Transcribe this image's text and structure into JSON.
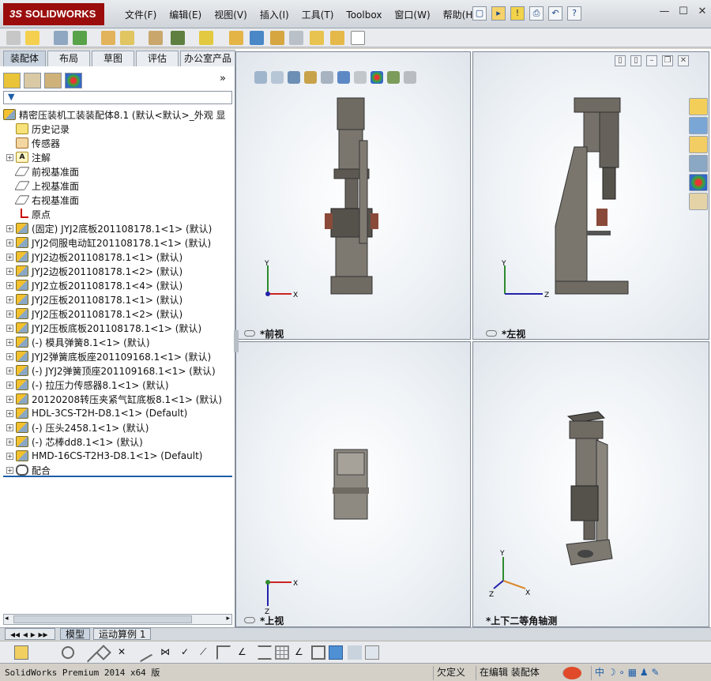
{
  "app": {
    "logo_ds": "3S",
    "logo_text": "SOLIDWORKS"
  },
  "menu": [
    "文件(F)",
    "编辑(E)",
    "视图(V)",
    "插入(I)",
    "工具(T)",
    "Toolbox",
    "窗口(W)",
    "帮助(H)"
  ],
  "window_buttons": [
    "—",
    "☐",
    "✕"
  ],
  "manager_tabs": [
    "装配体",
    "布局",
    "草图",
    "评估",
    "办公室产品"
  ],
  "tree": {
    "root": "精密压装机工装装配体8.1  (默认<默认>_外观 显",
    "items": [
      {
        "label": "历史记录",
        "icon": "history-icon",
        "expand": false
      },
      {
        "label": "传感器",
        "icon": "sensor-icon",
        "expand": false
      },
      {
        "label": "注解",
        "icon": "annotation-icon",
        "expand": true
      },
      {
        "label": "前视基准面",
        "icon": "plane-icon",
        "expand": false
      },
      {
        "label": "上视基准面",
        "icon": "plane-icon",
        "expand": false
      },
      {
        "label": "右视基准面",
        "icon": "plane-icon",
        "expand": false
      },
      {
        "label": "原点",
        "icon": "origin-icon",
        "expand": false
      },
      {
        "label": "(固定) JYJ2底板201108178.1<1> (默认)",
        "icon": "part-icon",
        "expand": true
      },
      {
        "label": "JYJ2伺服电动缸201108178.1<1> (默认)",
        "icon": "part-icon",
        "expand": true
      },
      {
        "label": "JYJ2边板201108178.1<1> (默认)",
        "icon": "part-icon",
        "expand": true
      },
      {
        "label": "JYJ2边板201108178.1<2> (默认)",
        "icon": "part-icon",
        "expand": true
      },
      {
        "label": "JYJ2立板201108178.1<4> (默认)",
        "icon": "part-icon",
        "expand": true
      },
      {
        "label": "JYJ2压板201108178.1<1> (默认)",
        "icon": "part-icon",
        "expand": true
      },
      {
        "label": "JYJ2压板201108178.1<2> (默认)",
        "icon": "part-icon",
        "expand": true
      },
      {
        "label": "JYJ2压板底板201108178.1<1> (默认)",
        "icon": "part-icon",
        "expand": true
      },
      {
        "label": "(-) 模具弹簧8.1<1> (默认)",
        "icon": "part-icon",
        "expand": true
      },
      {
        "label": "JYJ2弹簧底板座201109168.1<1> (默认)",
        "icon": "part-icon",
        "expand": true
      },
      {
        "label": "(-) JYJ2弹簧顶座201109168.1<1> (默认)",
        "icon": "part-icon",
        "expand": true
      },
      {
        "label": "(-) 拉压力传感器8.1<1> (默认)",
        "icon": "part-icon",
        "expand": true
      },
      {
        "label": "20120208转压夹紧气缸底板8.1<1> (默认)",
        "icon": "part-icon",
        "expand": true
      },
      {
        "label": "HDL-3CS-T2H-D8.1<1> (Default)",
        "icon": "part-icon",
        "expand": true
      },
      {
        "label": "(-) 压头2458.1<1> (默认)",
        "icon": "part-icon",
        "expand": true
      },
      {
        "label": "(-) 芯棒dd8.1<1> (默认)",
        "icon": "part-icon",
        "expand": true
      },
      {
        "label": "HMD-16CS-T2H3-D8.1<1> (Default)",
        "icon": "part-icon",
        "expand": true
      },
      {
        "label": "配合",
        "icon": "mate-icon",
        "expand": true
      }
    ]
  },
  "viewports": {
    "front": {
      "label": "*前视",
      "axes": [
        "Y",
        "X"
      ]
    },
    "left": {
      "label": "*左视",
      "axes": [
        "Y",
        "Z"
      ]
    },
    "top": {
      "label": "*上视",
      "axes": [
        "X",
        "Z"
      ]
    },
    "iso": {
      "label": "*上下二等角轴测",
      "axes": [
        "Y",
        "X",
        "Z"
      ]
    }
  },
  "bottom_tabs": [
    "模型",
    "运动算例 1"
  ],
  "status": {
    "product": "SolidWorks Premium 2014 x64 版",
    "defined": "欠定义",
    "editing": "在编辑 装配体"
  },
  "colors": {
    "logo_red": "#9b0d0d",
    "selection_blue": "#1e5ea8",
    "model_gray": "#6f6a62"
  }
}
